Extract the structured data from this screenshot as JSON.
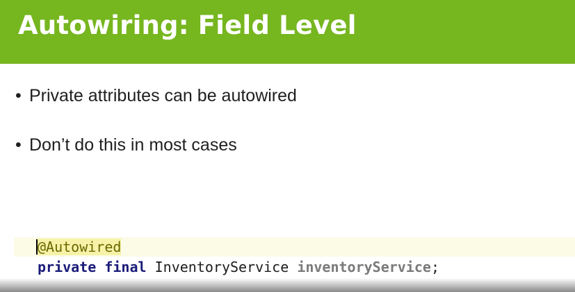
{
  "slide": {
    "title": "Autowiring: Field Level",
    "bullets": [
      {
        "marker": "•",
        "text": "Private attributes can be autowired"
      },
      {
        "marker": "•",
        "text": "Don’t do this in most cases"
      }
    ]
  },
  "code": {
    "annotation": "@Autowired",
    "keyword_1": "private",
    "keyword_2": "final",
    "type": "InventoryService",
    "field": "inventoryService",
    "terminator": ";"
  },
  "colors": {
    "title_bar": "#76b61f",
    "title_text": "#ffffff",
    "body_text": "#202020",
    "annotation_text": "#696900",
    "annotation_highlight": "#f7f2a8",
    "line_highlight": "#fbfbe6",
    "keyword": "#1a1a7a",
    "field": "#7a7a7a"
  }
}
